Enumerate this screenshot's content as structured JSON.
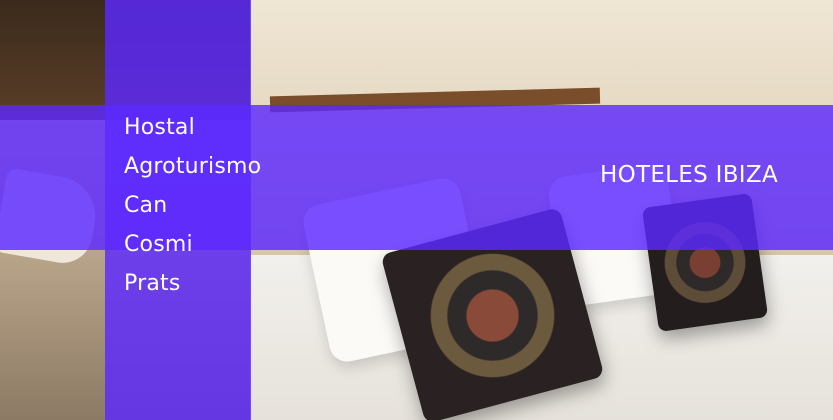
{
  "hero": {
    "image_subject": "hotel-bedroom-photo",
    "overlay_color": "#5c28ff"
  },
  "title": {
    "lines": [
      "Hostal",
      "Agroturismo",
      "Can",
      "Cosmi",
      "Prats"
    ]
  },
  "category": {
    "label": "HOTELES IBIZA"
  }
}
